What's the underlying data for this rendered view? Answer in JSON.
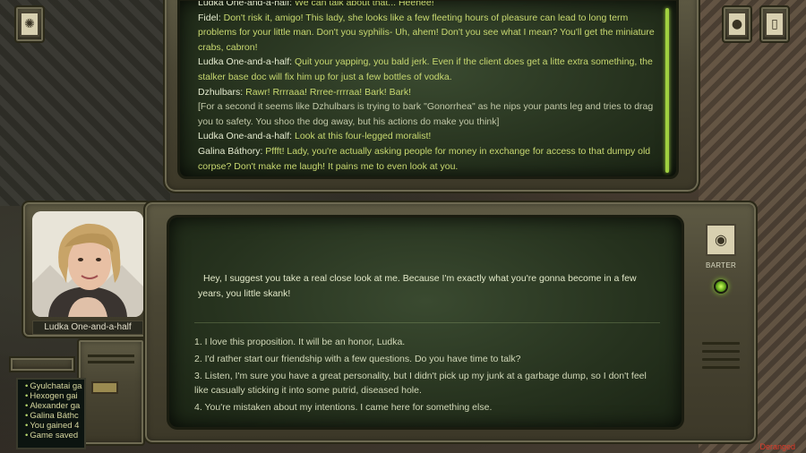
{
  "log": {
    "lines": [
      {
        "speaker": "Ludka One-and-a-half:",
        "text": "We can talk about that... Heehee!",
        "kind": "speech"
      },
      {
        "speaker": "Fidel:",
        "text": "Don't risk it, amigo! This lady, she looks like a few fleeting hours of pleasure can lead to long term problems for your little man. Don't you syphilis- Uh, ahem! Don't you see what I mean? You'll get the miniature crabs, cabron!",
        "kind": "speech"
      },
      {
        "speaker": "Ludka One-and-a-half:",
        "text": "Quit your yapping, you bald jerk. Even if the client does get a litte extra something, the stalker base doc will fix him up for just a few bottles of vodka.",
        "kind": "speech"
      },
      {
        "speaker": "Dzhulbars:",
        "text": "Rawr! Rrrraaa! Rrree-rrrraa! Bark! Bark!",
        "kind": "speech"
      },
      {
        "speaker": "",
        "text": "[For a second it seems like Dzhulbars is trying to bark \"Gonorrhea\" as he nips your pants leg and tries to drag you to safety. You shoo the dog away, but his actions do make you think]",
        "kind": "narr"
      },
      {
        "speaker": "Ludka One-and-a-half:",
        "text": "Look at this four-legged moralist!",
        "kind": "speech"
      },
      {
        "speaker": "Galina Báthory:",
        "text": "Pffft! Lady, you're actually asking people for money in exchange for access to that dumpy old corpse? Don't make me laugh! It pains me to even look at you.",
        "kind": "speech"
      }
    ]
  },
  "portrait": {
    "name": "Ludka One-and-a-half"
  },
  "dialog": {
    "npc_speech": "Hey, I suggest you take a real close look at me. Because I'm exactly what you're gonna become in a few years, you little skank!",
    "options": [
      "1. I love this proposition. It will be an honor, Ludka.",
      "2. I'd rather start our friendship with a few questions. Do you have time to talk?",
      "3. Listen, I'm sure you have a great personality, but I didn't pick up my junk at a garbage dump, so I don't feel like casually sticking it into some putrid, diseased hole.",
      "4. You're mistaken about my intentions. I came here for something else."
    ]
  },
  "barter": {
    "label": "BARTER",
    "icon": "money-bag-icon"
  },
  "gamelog": {
    "entries": [
      "Gyulchatai ga",
      "Hexogen gai",
      "Alexander ga",
      "Galina Báthc",
      "You gained 4",
      "Game saved"
    ]
  },
  "status": {
    "deranged": "Deranged"
  },
  "colors": {
    "accent_green": "#a0d040",
    "speech_green": "#c8d870",
    "status_red": "#e03a2a"
  }
}
